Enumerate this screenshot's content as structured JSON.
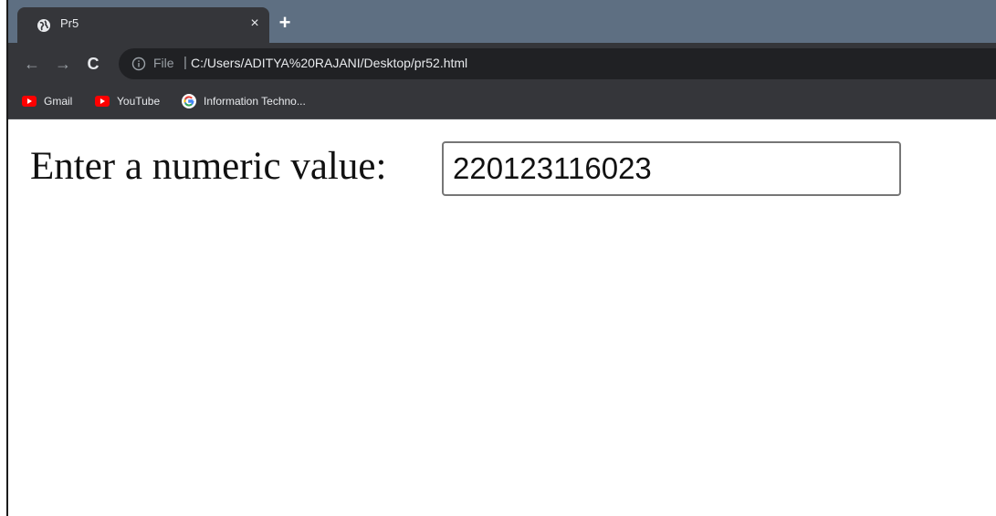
{
  "browser": {
    "tab": {
      "title": "Pr5",
      "close_glyph": "×",
      "favicon": "globe-icon"
    },
    "new_tab_glyph": "+",
    "toolbar": {
      "back_glyph": "←",
      "forward_glyph": "→",
      "reload_glyph": "C",
      "scheme_label": "File",
      "separator": "|",
      "url": "C:/Users/ADITYA%20RAJANI/Desktop/pr52.html"
    },
    "bookmarks": [
      {
        "label": "Gmail",
        "icon": "youtube-icon"
      },
      {
        "label": "YouTube",
        "icon": "youtube-icon"
      },
      {
        "label": "Information Techno...",
        "icon": "google-icon"
      }
    ]
  },
  "page": {
    "prompt_label": "Enter a numeric value:",
    "numeric_input_value": "220123116023"
  },
  "colors": {
    "tab_strip": "#5e6f82",
    "toolbar": "#35363a",
    "omnibox": "#202124",
    "youtube_red": "#ff0000"
  }
}
